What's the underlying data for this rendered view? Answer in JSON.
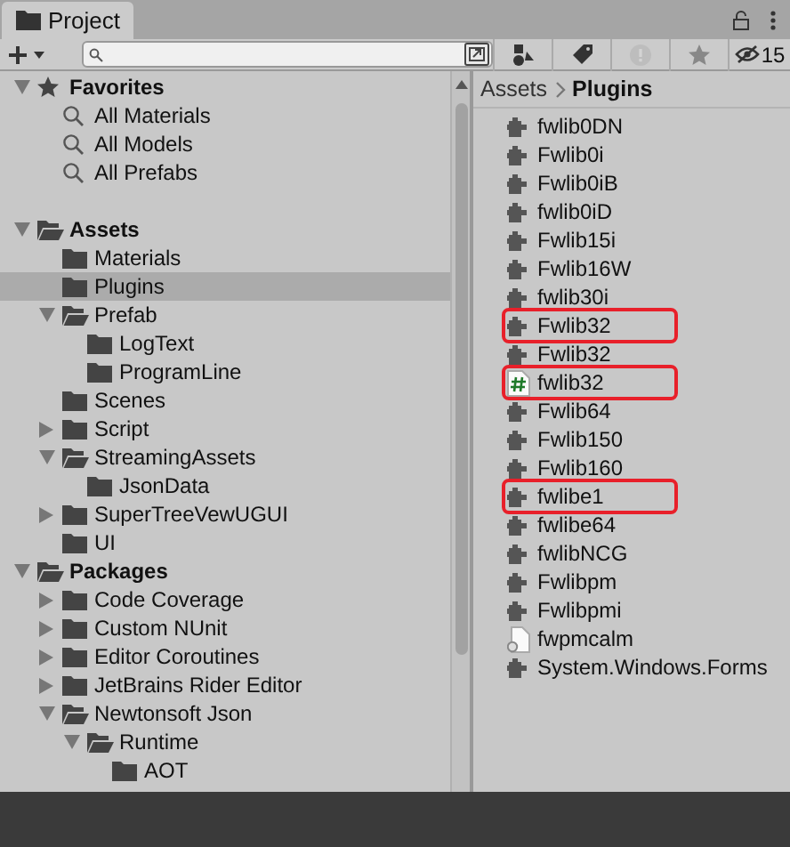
{
  "window": {
    "title": "Project",
    "locked": false
  },
  "toolbar": {
    "hidden_count": "15"
  },
  "tree": [
    {
      "label": "Favorites",
      "kind": "favorites",
      "expanded": true,
      "selected": false,
      "children": [
        {
          "label": "All Materials",
          "kind": "search",
          "selected": false
        },
        {
          "label": "All Models",
          "kind": "search",
          "selected": false
        },
        {
          "label": "All Prefabs",
          "kind": "search",
          "selected": false
        }
      ]
    },
    {
      "label": "Assets",
      "kind": "folder",
      "expanded": true,
      "selected": false,
      "children": [
        {
          "label": "Materials",
          "kind": "folder",
          "selected": false
        },
        {
          "label": "Plugins",
          "kind": "folder",
          "selected": true
        },
        {
          "label": "Prefab",
          "kind": "folder",
          "expanded": true,
          "selected": false,
          "children": [
            {
              "label": "LogText",
              "kind": "folder",
              "selected": false
            },
            {
              "label": "ProgramLine",
              "kind": "folder",
              "selected": false
            }
          ]
        },
        {
          "label": "Scenes",
          "kind": "folder",
          "selected": false
        },
        {
          "label": "Script",
          "kind": "folder",
          "expanded": false,
          "selected": false
        },
        {
          "label": "StreamingAssets",
          "kind": "folder",
          "expanded": true,
          "selected": false,
          "children": [
            {
              "label": "JsonData",
              "kind": "folder",
              "selected": false
            }
          ]
        },
        {
          "label": "SuperTreeVewUGUI",
          "kind": "folder",
          "expanded": false,
          "selected": false
        },
        {
          "label": "UI",
          "kind": "folder",
          "selected": false
        }
      ]
    },
    {
      "label": "Packages",
      "kind": "folder",
      "expanded": true,
      "selected": false,
      "children": [
        {
          "label": "Code Coverage",
          "kind": "folder",
          "expanded": false,
          "selected": false
        },
        {
          "label": "Custom NUnit",
          "kind": "folder",
          "expanded": false,
          "selected": false
        },
        {
          "label": "Editor Coroutines",
          "kind": "folder",
          "expanded": false,
          "selected": false
        },
        {
          "label": "JetBrains Rider Editor",
          "kind": "folder",
          "expanded": false,
          "selected": false
        },
        {
          "label": "Newtonsoft Json",
          "kind": "folder",
          "expanded": true,
          "selected": false,
          "children": [
            {
              "label": "Runtime",
              "kind": "folder",
              "expanded": true,
              "selected": false,
              "children": [
                {
                  "label": "AOT",
                  "kind": "folder",
                  "selected": false
                }
              ]
            }
          ]
        }
      ]
    }
  ],
  "breadcrumb": [
    {
      "label": "Assets",
      "current": false
    },
    {
      "label": "Plugins",
      "current": true
    }
  ],
  "files": [
    {
      "name": "fwlib0DN",
      "kind": "plugin",
      "highlighted": false
    },
    {
      "name": "Fwlib0i",
      "kind": "plugin",
      "highlighted": false
    },
    {
      "name": "Fwlib0iB",
      "kind": "plugin",
      "highlighted": false
    },
    {
      "name": "fwlib0iD",
      "kind": "plugin",
      "highlighted": false
    },
    {
      "name": "Fwlib15i",
      "kind": "plugin",
      "highlighted": false
    },
    {
      "name": "Fwlib16W",
      "kind": "plugin",
      "highlighted": false
    },
    {
      "name": "fwlib30i",
      "kind": "plugin",
      "highlighted": false
    },
    {
      "name": "Fwlib32",
      "kind": "plugin",
      "highlighted": true
    },
    {
      "name": "Fwlib32",
      "kind": "plugin",
      "highlighted": false
    },
    {
      "name": "fwlib32",
      "kind": "script",
      "highlighted": true
    },
    {
      "name": "Fwlib64",
      "kind": "plugin",
      "highlighted": false
    },
    {
      "name": "Fwlib150",
      "kind": "plugin",
      "highlighted": false
    },
    {
      "name": "Fwlib160",
      "kind": "plugin",
      "highlighted": false
    },
    {
      "name": "fwlibe1",
      "kind": "plugin",
      "highlighted": true
    },
    {
      "name": "fwlibe64",
      "kind": "plugin",
      "highlighted": false
    },
    {
      "name": "fwlibNCG",
      "kind": "plugin",
      "highlighted": false
    },
    {
      "name": "Fwlibpm",
      "kind": "plugin",
      "highlighted": false
    },
    {
      "name": "Fwlibpmi",
      "kind": "plugin",
      "highlighted": false
    },
    {
      "name": "fwpmcalm",
      "kind": "file",
      "highlighted": false
    },
    {
      "name": "System.Windows.Forms",
      "kind": "plugin",
      "highlighted": false
    }
  ]
}
